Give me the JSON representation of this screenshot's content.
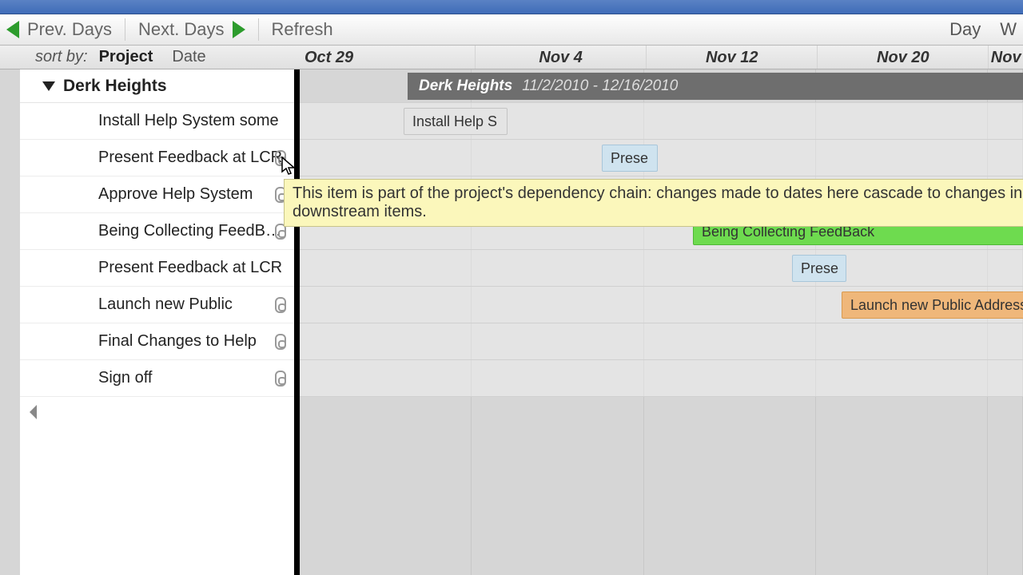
{
  "toolbar": {
    "prev_label": "Prev. Days",
    "next_label": "Next. Days",
    "refresh_label": "Refresh",
    "day_label": "Day",
    "week_partial": "W"
  },
  "sortbar": {
    "label": "sort by:",
    "project": "Project",
    "date": "Date",
    "dates": [
      "Oct 29",
      "Nov 4",
      "Nov 12",
      "Nov 20",
      "Nov"
    ]
  },
  "group": {
    "name": "Derk Heights"
  },
  "tasks": [
    {
      "label": "Install Help System some",
      "chain": false
    },
    {
      "label": "Present Feedback at LCR",
      "chain": true
    },
    {
      "label": "Approve Help System",
      "chain": true
    },
    {
      "label": "Being Collecting FeedBack",
      "chain": true
    },
    {
      "label": "Present Feedback at LCR",
      "chain": false
    },
    {
      "label": "Launch new Public",
      "chain": true
    },
    {
      "label": "Final Changes to Help",
      "chain": true
    },
    {
      "label": "Sign off",
      "chain": true
    }
  ],
  "gantt": {
    "project_name": "Derk Heights",
    "project_range": "11/2/2010 - 12/16/2010",
    "bars": {
      "install": "Install Help S",
      "present1": "Prese",
      "collecting": "Being Collecting FeedBack",
      "present2": "Prese",
      "launch": "Launch new Public Address"
    }
  },
  "tooltip": "This item is part of the project's dependency chain: changes made to dates here cascade to changes in downstream items."
}
